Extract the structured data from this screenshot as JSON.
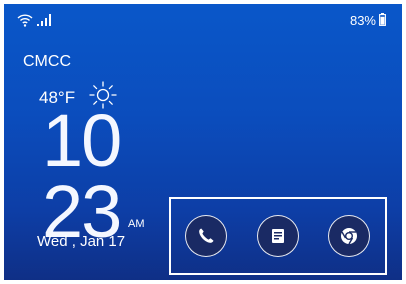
{
  "status_bar": {
    "wifi_icon": "wifi-icon",
    "signal_icon": "signal-icon",
    "battery_level": "83%",
    "battery_icon": "battery-icon"
  },
  "carrier": "CMCC",
  "weather": {
    "temperature": "48°F",
    "icon": "sun-icon"
  },
  "clock": {
    "hour": "10",
    "minute": "23",
    "ampm": "AM",
    "date": "Wed , Jan 17"
  },
  "shortcuts": [
    {
      "name": "phone",
      "icon": "phone-icon"
    },
    {
      "name": "messages",
      "icon": "messages-icon"
    },
    {
      "name": "chrome",
      "icon": "chrome-icon"
    }
  ],
  "colors": {
    "background_top": "#0a57c9",
    "background_bottom": "#0f2f86",
    "shortcut_fill": "#1a2a64",
    "text": "#ffffff"
  }
}
